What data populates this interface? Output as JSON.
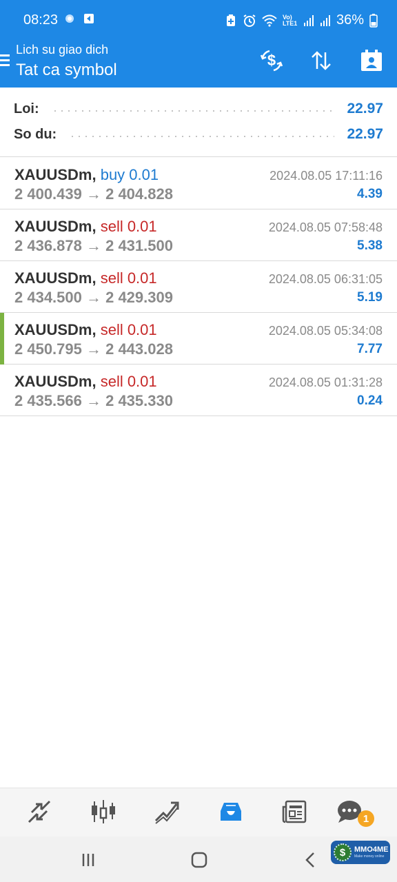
{
  "status_bar": {
    "time": "08:23",
    "network": "Vo) LTE1",
    "battery": "36%"
  },
  "header": {
    "subtitle": "Lich su giao dich",
    "title": "Tat ca symbol",
    "icons": [
      "menu-icon",
      "currency-exchange-icon",
      "sort-icon",
      "calendar-person-icon"
    ]
  },
  "summary": {
    "profit_label": "Loi:",
    "profit_value": "22.97",
    "balance_label": "So du:",
    "balance_value": "22.97"
  },
  "trades": [
    {
      "symbol": "XAUUSDm,",
      "side": "buy 0.01",
      "type": "buy",
      "prices": "2 400.439 → 2 404.828",
      "time": "2024.08.05 17:11:16",
      "profit": "4.39"
    },
    {
      "symbol": "XAUUSDm,",
      "side": "sell 0.01",
      "type": "sell",
      "prices": "2 436.878 → 2 431.500",
      "time": "2024.08.05 07:58:48",
      "profit": "5.38"
    },
    {
      "symbol": "XAUUSDm,",
      "side": "sell 0.01",
      "type": "sell",
      "prices": "2 434.500 → 2 429.309",
      "time": "2024.08.05 06:31:05",
      "profit": "5.19"
    },
    {
      "symbol": "XAUUSDm,",
      "side": "sell 0.01",
      "type": "sell",
      "prices": "2 450.795 → 2 443.028",
      "time": "2024.08.05 05:34:08",
      "profit": "7.77"
    },
    {
      "symbol": "XAUUSDm,",
      "side": "sell 0.01",
      "type": "sell",
      "prices": "2 435.566 → 2 435.330",
      "time": "2024.08.05 01:31:28",
      "profit": "0.24"
    }
  ],
  "bottom_nav": {
    "items": [
      "quotes-icon",
      "chart-icon",
      "trade-icon",
      "history-icon",
      "news-icon",
      "chat-icon"
    ],
    "active": "history-icon",
    "chat_badge": "1"
  },
  "watermark": {
    "name": "MMO4ME",
    "tagline": "Make money online"
  },
  "colors": {
    "accent": "#1e88e5",
    "buy": "#1e7bd0",
    "sell": "#c62828",
    "profit": "#1e7bd0",
    "selected_marker": "#7cb342"
  }
}
